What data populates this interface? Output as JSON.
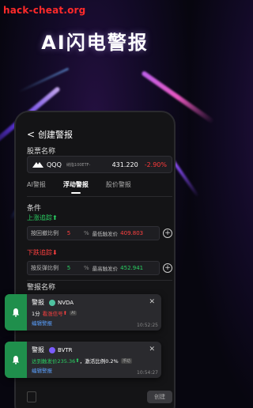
{
  "watermark": "hack-cheat.org",
  "hero": {
    "title": "AI闪电警报"
  },
  "nav": {
    "back_glyph": "<",
    "title": "创建警报"
  },
  "stock": {
    "section_label": "股票名称",
    "code": "QQQ",
    "name": "纳指100ETF-",
    "price": "431.220",
    "change": "-2.90%"
  },
  "tabs": [
    {
      "label": "AI警报",
      "active": false
    },
    {
      "label": "浮动警报",
      "active": true
    },
    {
      "label": "股价警报",
      "active": false
    }
  ],
  "conditions": {
    "label": "条件",
    "up": {
      "title": "上涨追踪",
      "arrow": "⬆",
      "field_label": "按回撤比例",
      "value": "5",
      "unit": "%",
      "ref_label": "最低触发价",
      "ref_value": "409.803"
    },
    "down": {
      "title": "下跌追踪",
      "arrow": "⬇",
      "field_label": "按反弹比例",
      "value": "5",
      "unit": "%",
      "ref_label": "最高触发价",
      "ref_value": "452.941"
    },
    "plus_glyph": "+"
  },
  "alert_name": {
    "label": "警报名称"
  },
  "bottom": {
    "create_label": "创建"
  },
  "notifications": [
    {
      "title": "警报",
      "symbol": "NVDA",
      "line_prefix": "1分",
      "line_signal": "看涨信号",
      "arrow": "⬆",
      "line_tag": "AI",
      "edit_label": "编辑警报",
      "time": "10:52:25",
      "close_glyph": "✕",
      "chip_color": "#4fc3a1"
    },
    {
      "title": "警报",
      "symbol": "BVTR",
      "line_prefix": "达到触发价235.36",
      "line_signal": "，激活比例0.2%",
      "arrow": "⬆",
      "line_tag": "浮动",
      "edit_label": "编辑警报",
      "time": "10:54:27",
      "close_glyph": "✕",
      "chip_color": "#7b5cff"
    }
  ],
  "colors": {
    "up": "#2ad163",
    "down": "#ff4040",
    "notif_strip": "#1f8f4c",
    "price_down": "#ff3b3b"
  }
}
